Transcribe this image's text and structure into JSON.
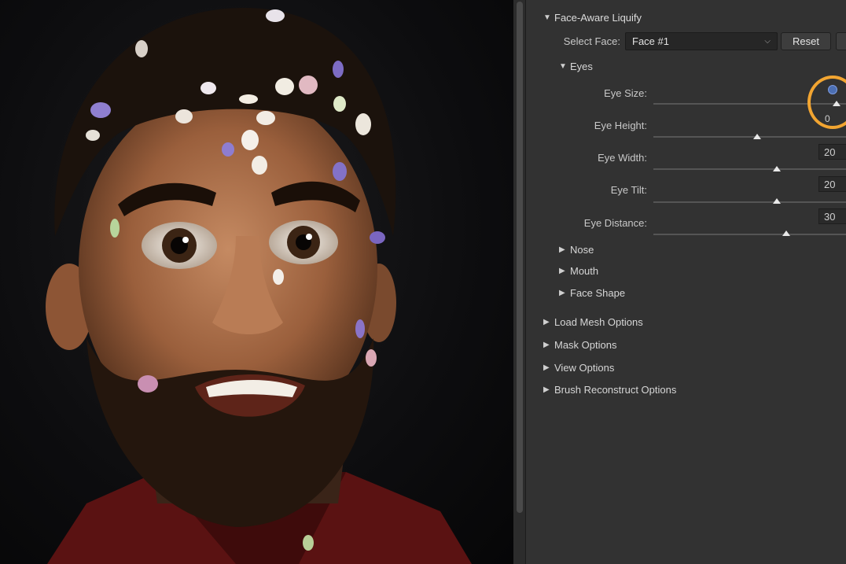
{
  "panel": {
    "section_title": "Face-Aware Liquify",
    "select_face_label": "Select Face:",
    "select_face_value": "Face #1",
    "reset_label": "Reset",
    "eyes_label": "Eyes",
    "sliders": [
      {
        "label": "Eye Size:",
        "value": "",
        "level": 0.95
      },
      {
        "label": "Eye Height:",
        "value": "0",
        "level": 0.54
      },
      {
        "label": "Eye Width:",
        "value": "20",
        "level": 0.64
      },
      {
        "label": "Eye Tilt:",
        "value": "20",
        "level": 0.64
      },
      {
        "label": "Eye Distance:",
        "value": "30",
        "level": 0.69
      }
    ],
    "subsections": [
      "Nose",
      "Mouth",
      "Face Shape"
    ],
    "options": [
      "Load Mesh Options",
      "Mask Options",
      "View Options",
      "Brush Reconstruct Options"
    ],
    "highlight_color": "#f2a531"
  },
  "icons": {
    "expanded": "triangle-down",
    "collapsed": "triangle-right",
    "dropdown": "chevron-down"
  }
}
